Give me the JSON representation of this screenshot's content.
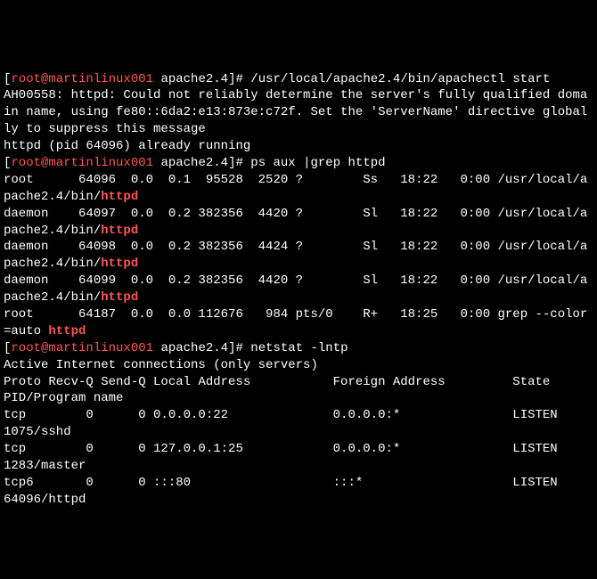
{
  "p1_open": "[",
  "p1_userhost": "root@martinlinux001",
  "p1_space": " ",
  "p1_dir": "apache2.4",
  "p1_close": "]# ",
  "cmd1": "/usr/local/apache2.4/bin/apachectl start",
  "out1": "AH00558: httpd: Could not reliably determine the server's fully qualified domain name, using fe80::6da2:e13:873e:c72f. Set the 'ServerName' directive globally to suppress this message",
  "out2": "httpd (pid 64096) already running",
  "cmd2": "ps aux |grep httpd",
  "ps_row1_a": "root      64096  0.0  0.1  95528  2520 ?        Ss   18:22   0:00 /usr/local/apache2.4/bin/",
  "ps_row1_hl": "httpd",
  "ps_row2_a": "daemon    64097  0.0  0.2 382356  4420 ?        Sl   18:22   0:00 /usr/local/apache2.4/bin/",
  "ps_row2_hl": "httpd",
  "ps_row3_a": "daemon    64098  0.0  0.2 382356  4424 ?        Sl   18:22   0:00 /usr/local/apache2.4/bin/",
  "ps_row3_hl": "httpd",
  "ps_row4_a": "daemon    64099  0.0  0.2 382356  4420 ?        Sl   18:22   0:00 /usr/local/apache2.4/bin/",
  "ps_row4_hl": "httpd",
  "ps_row5_a": "root      64187  0.0  0.0 112676   984 pts/0    R+   18:25   0:00 grep --color=auto ",
  "ps_row5_hl": "httpd",
  "cmd3": "netstat -lntp",
  "ns_hdr1": "Active Internet connections (only servers)",
  "ns_hdr2": "Proto Recv-Q Send-Q Local Address           Foreign Address         State       PID/Program name",
  "ns_row1": "tcp        0      0 0.0.0.0:22              0.0.0.0:*               LISTEN      1075/sshd",
  "ns_row2": "tcp        0      0 127.0.0.1:25            0.0.0.0:*               LISTEN      1283/master",
  "ns_row3": "tcp6       0      0 :::80                   :::*                    LISTEN      64096/httpd"
}
